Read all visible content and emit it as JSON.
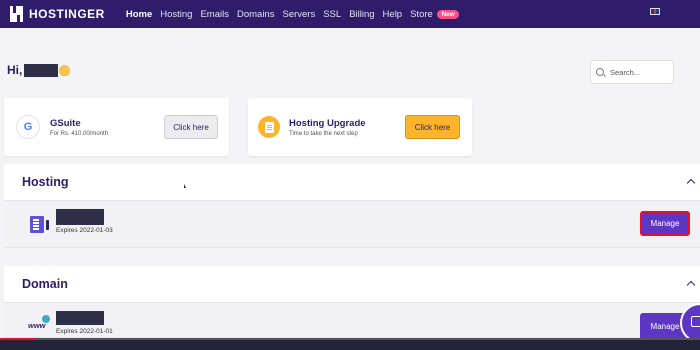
{
  "nav": {
    "logo_text": "HOSTINGER",
    "items": [
      {
        "label": "Home",
        "active": true
      },
      {
        "label": "Hosting"
      },
      {
        "label": "Emails"
      },
      {
        "label": "Domains"
      },
      {
        "label": "Servers"
      },
      {
        "label": "SSL"
      },
      {
        "label": "Billing"
      },
      {
        "label": "Help"
      },
      {
        "label": "Store",
        "badge": "New"
      }
    ]
  },
  "greeting": {
    "text": "Hi,"
  },
  "search": {
    "placeholder": "Search..."
  },
  "promos": [
    {
      "title": "GSuite",
      "subtitle": "For Rs. 410.00/month",
      "button": "Click here",
      "icon": "google-g-icon",
      "icon_glyph": "G"
    },
    {
      "title": "Hosting Upgrade",
      "subtitle": "Time to take the next step",
      "button": "Click here",
      "icon": "upgrade-icon"
    }
  ],
  "sections": [
    {
      "title": "Hosting",
      "items": [
        {
          "expires": "Expires 2022-01-03",
          "button": "Manage",
          "icon": "server-icon"
        }
      ]
    },
    {
      "title": "Domain",
      "items": [
        {
          "expires": "Expires 2022-01-01",
          "button": "Manage",
          "icon": "www-icon",
          "icon_text": "www"
        }
      ]
    }
  ],
  "colors": {
    "nav_bg": "#2f1c6a",
    "accent_purple": "#5e36c4",
    "accent_yellow": "#fcb52b",
    "badge_pink": "#fc5185",
    "highlight_red": "#e0132b"
  }
}
